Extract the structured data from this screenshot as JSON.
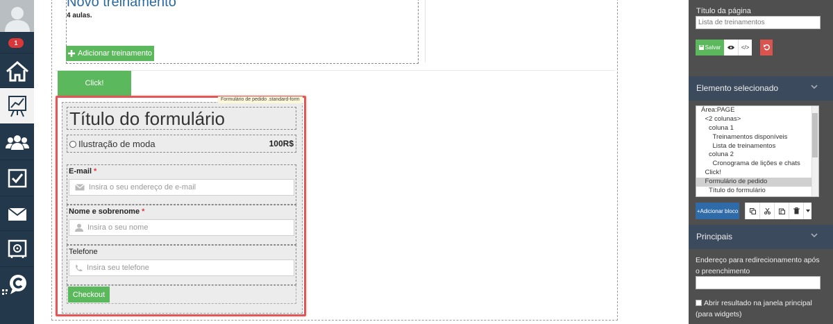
{
  "nav": {
    "badge_count": "1",
    "items": [
      "home",
      "presentation",
      "users",
      "tasks",
      "mail",
      "safe",
      "chat"
    ]
  },
  "canvas": {
    "course_title": "Novo treinamento",
    "course_subtitle": "4 aulas.",
    "add_training_label": "Adicionar treinamento",
    "click_button_label": "Click!"
  },
  "form": {
    "tag": "Formulário de pedido .standard-form",
    "title": "Título do formulário",
    "product_name": "Ilustração de moda",
    "product_price": "100R$",
    "email_label": "E-mail",
    "email_placeholder": "Insira o seu endereço de e-mail",
    "name_label": "Nome e sobrenome",
    "name_placeholder": "Insira o seu nome",
    "phone_label": "Telefone",
    "phone_placeholder": "Insira seu telefone",
    "required_mark": "*",
    "checkout_label": "Checkout"
  },
  "panel": {
    "page_title_label": "Título da página",
    "page_title_value": "Lista de treinamentos",
    "save_label": "Salvar",
    "code_label": "</>",
    "selected_header": "Elemento selecionado",
    "tree": [
      {
        "label": "Área:PAGE",
        "indent": 0,
        "selected": false
      },
      {
        "label": "<2 colunas>",
        "indent": 1,
        "selected": false
      },
      {
        "label": "coluna 1",
        "indent": 2,
        "selected": false
      },
      {
        "label": "Treinamentos disponíveis",
        "indent": 3,
        "selected": false
      },
      {
        "label": "Lista de treinamentos",
        "indent": 3,
        "selected": false
      },
      {
        "label": "coluna 2",
        "indent": 2,
        "selected": false
      },
      {
        "label": "Cronograma de lições e chats",
        "indent": 3,
        "selected": false
      },
      {
        "label": "Click!",
        "indent": 1,
        "selected": false
      },
      {
        "label": "Formulário de pedido",
        "indent": 1,
        "selected": true
      },
      {
        "label": "Título do formulário",
        "indent": 2,
        "selected": false
      }
    ],
    "add_block_label": "+Adicionar bloco",
    "main_header": "Principais",
    "redirect_label": "Endereço para redirecionamento após o preenchimento",
    "redirect_value": "",
    "open_result_label": "Abrir resultado na janela principal (para widgets)"
  },
  "colors": {
    "nav_bg": "#24384b",
    "accent_green": "#5cb85c",
    "selection_red": "#e15656",
    "link_blue": "#2b6aa0",
    "panel_bg": "#4f4f4f",
    "panel_header": "#3b4a5c"
  }
}
